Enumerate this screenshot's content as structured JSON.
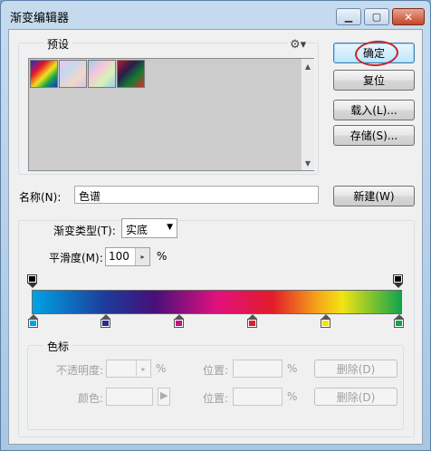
{
  "window": {
    "title": "渐变编辑器"
  },
  "presets": {
    "legend": "预设",
    "swatch_count": 4
  },
  "buttons": {
    "ok": "确定",
    "reset": "复位",
    "load": "载入(L)...",
    "save": "存储(S)...",
    "new": "新建(W)",
    "delete_opacity": "删除(D)",
    "delete_color": "删除(D)"
  },
  "name": {
    "label": "名称(N):",
    "value": "色谱"
  },
  "gradient": {
    "type_label": "渐变类型(T):",
    "type_value": "实底",
    "smooth_label": "平滑度(M):",
    "smooth_value": "100",
    "smooth_unit": "%",
    "colors": [
      "#00a3e4",
      "#1d3a9a",
      "#46107a",
      "#e0117f",
      "#e21b2a",
      "#f5a21b",
      "#f2e413",
      "#12a34d"
    ],
    "color_stops": [
      {
        "position": 0,
        "color": "#00a3e4"
      },
      {
        "position": 20,
        "color": "#2a2f8a"
      },
      {
        "position": 40,
        "color": "#c21380"
      },
      {
        "position": 60,
        "color": "#e21b2a"
      },
      {
        "position": 80,
        "color": "#f2e413"
      },
      {
        "position": 100,
        "color": "#12a34d"
      }
    ],
    "opacity_stops": [
      {
        "position": 0,
        "color": "#000000"
      },
      {
        "position": 100,
        "color": "#000000"
      }
    ]
  },
  "stops_section": {
    "legend": "色标",
    "opacity_label": "不透明度:",
    "opacity_unit": "%",
    "location_label_1": "位置:",
    "location_unit_1": "%",
    "color_label": "颜色:",
    "location_label_2": "位置:",
    "location_unit_2": "%"
  }
}
